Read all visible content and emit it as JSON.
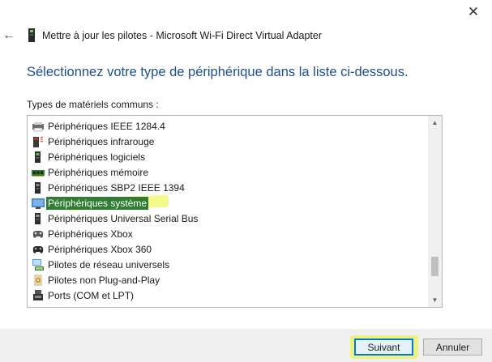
{
  "window": {
    "title": "Mettre à jour les pilotes - Microsoft Wi-Fi Direct Virtual Adapter",
    "close_glyph": "✕",
    "back_glyph": "←"
  },
  "instruction": "Sélectionnez votre type de périphérique dans la liste ci-dessous.",
  "list_label": "Types de matériels communs :",
  "device_types": [
    {
      "label": "Périphériques IEEE 1284.4",
      "icon": "printer-port-icon",
      "selected": false
    },
    {
      "label": "Périphériques infrarouge",
      "icon": "infrared-icon",
      "selected": false
    },
    {
      "label": "Périphériques logiciels",
      "icon": "software-device-icon",
      "selected": false
    },
    {
      "label": "Périphériques mémoire",
      "icon": "memory-icon",
      "selected": false
    },
    {
      "label": "Périphériques SBP2 IEEE 1394",
      "icon": "firewire-icon",
      "selected": false
    },
    {
      "label": "Périphériques système",
      "icon": "system-device-icon",
      "selected": true
    },
    {
      "label": "Périphériques Universal Serial Bus",
      "icon": "usb-icon",
      "selected": false
    },
    {
      "label": "Périphériques Xbox",
      "icon": "xbox-controller-icon",
      "selected": false
    },
    {
      "label": "Périphériques Xbox 360",
      "icon": "xbox-360-controller-icon",
      "selected": false
    },
    {
      "label": "Pilotes de réseau universels",
      "icon": "network-icon",
      "selected": false
    },
    {
      "label": "Pilotes non Plug-and-Play",
      "icon": "non-pnp-icon",
      "selected": false
    },
    {
      "label": "Ports (COM et LPT)",
      "icon": "port-icon",
      "selected": false
    },
    {
      "label": "",
      "icon": "partial-item-icon",
      "selected": false
    }
  ],
  "buttons": {
    "next": "Suivant",
    "cancel": "Annuler"
  },
  "colors": {
    "instruction": "#1e4f8f",
    "selection": "#2e7d32",
    "highlighter": "#ebf528",
    "focus_border": "#0078d7"
  }
}
